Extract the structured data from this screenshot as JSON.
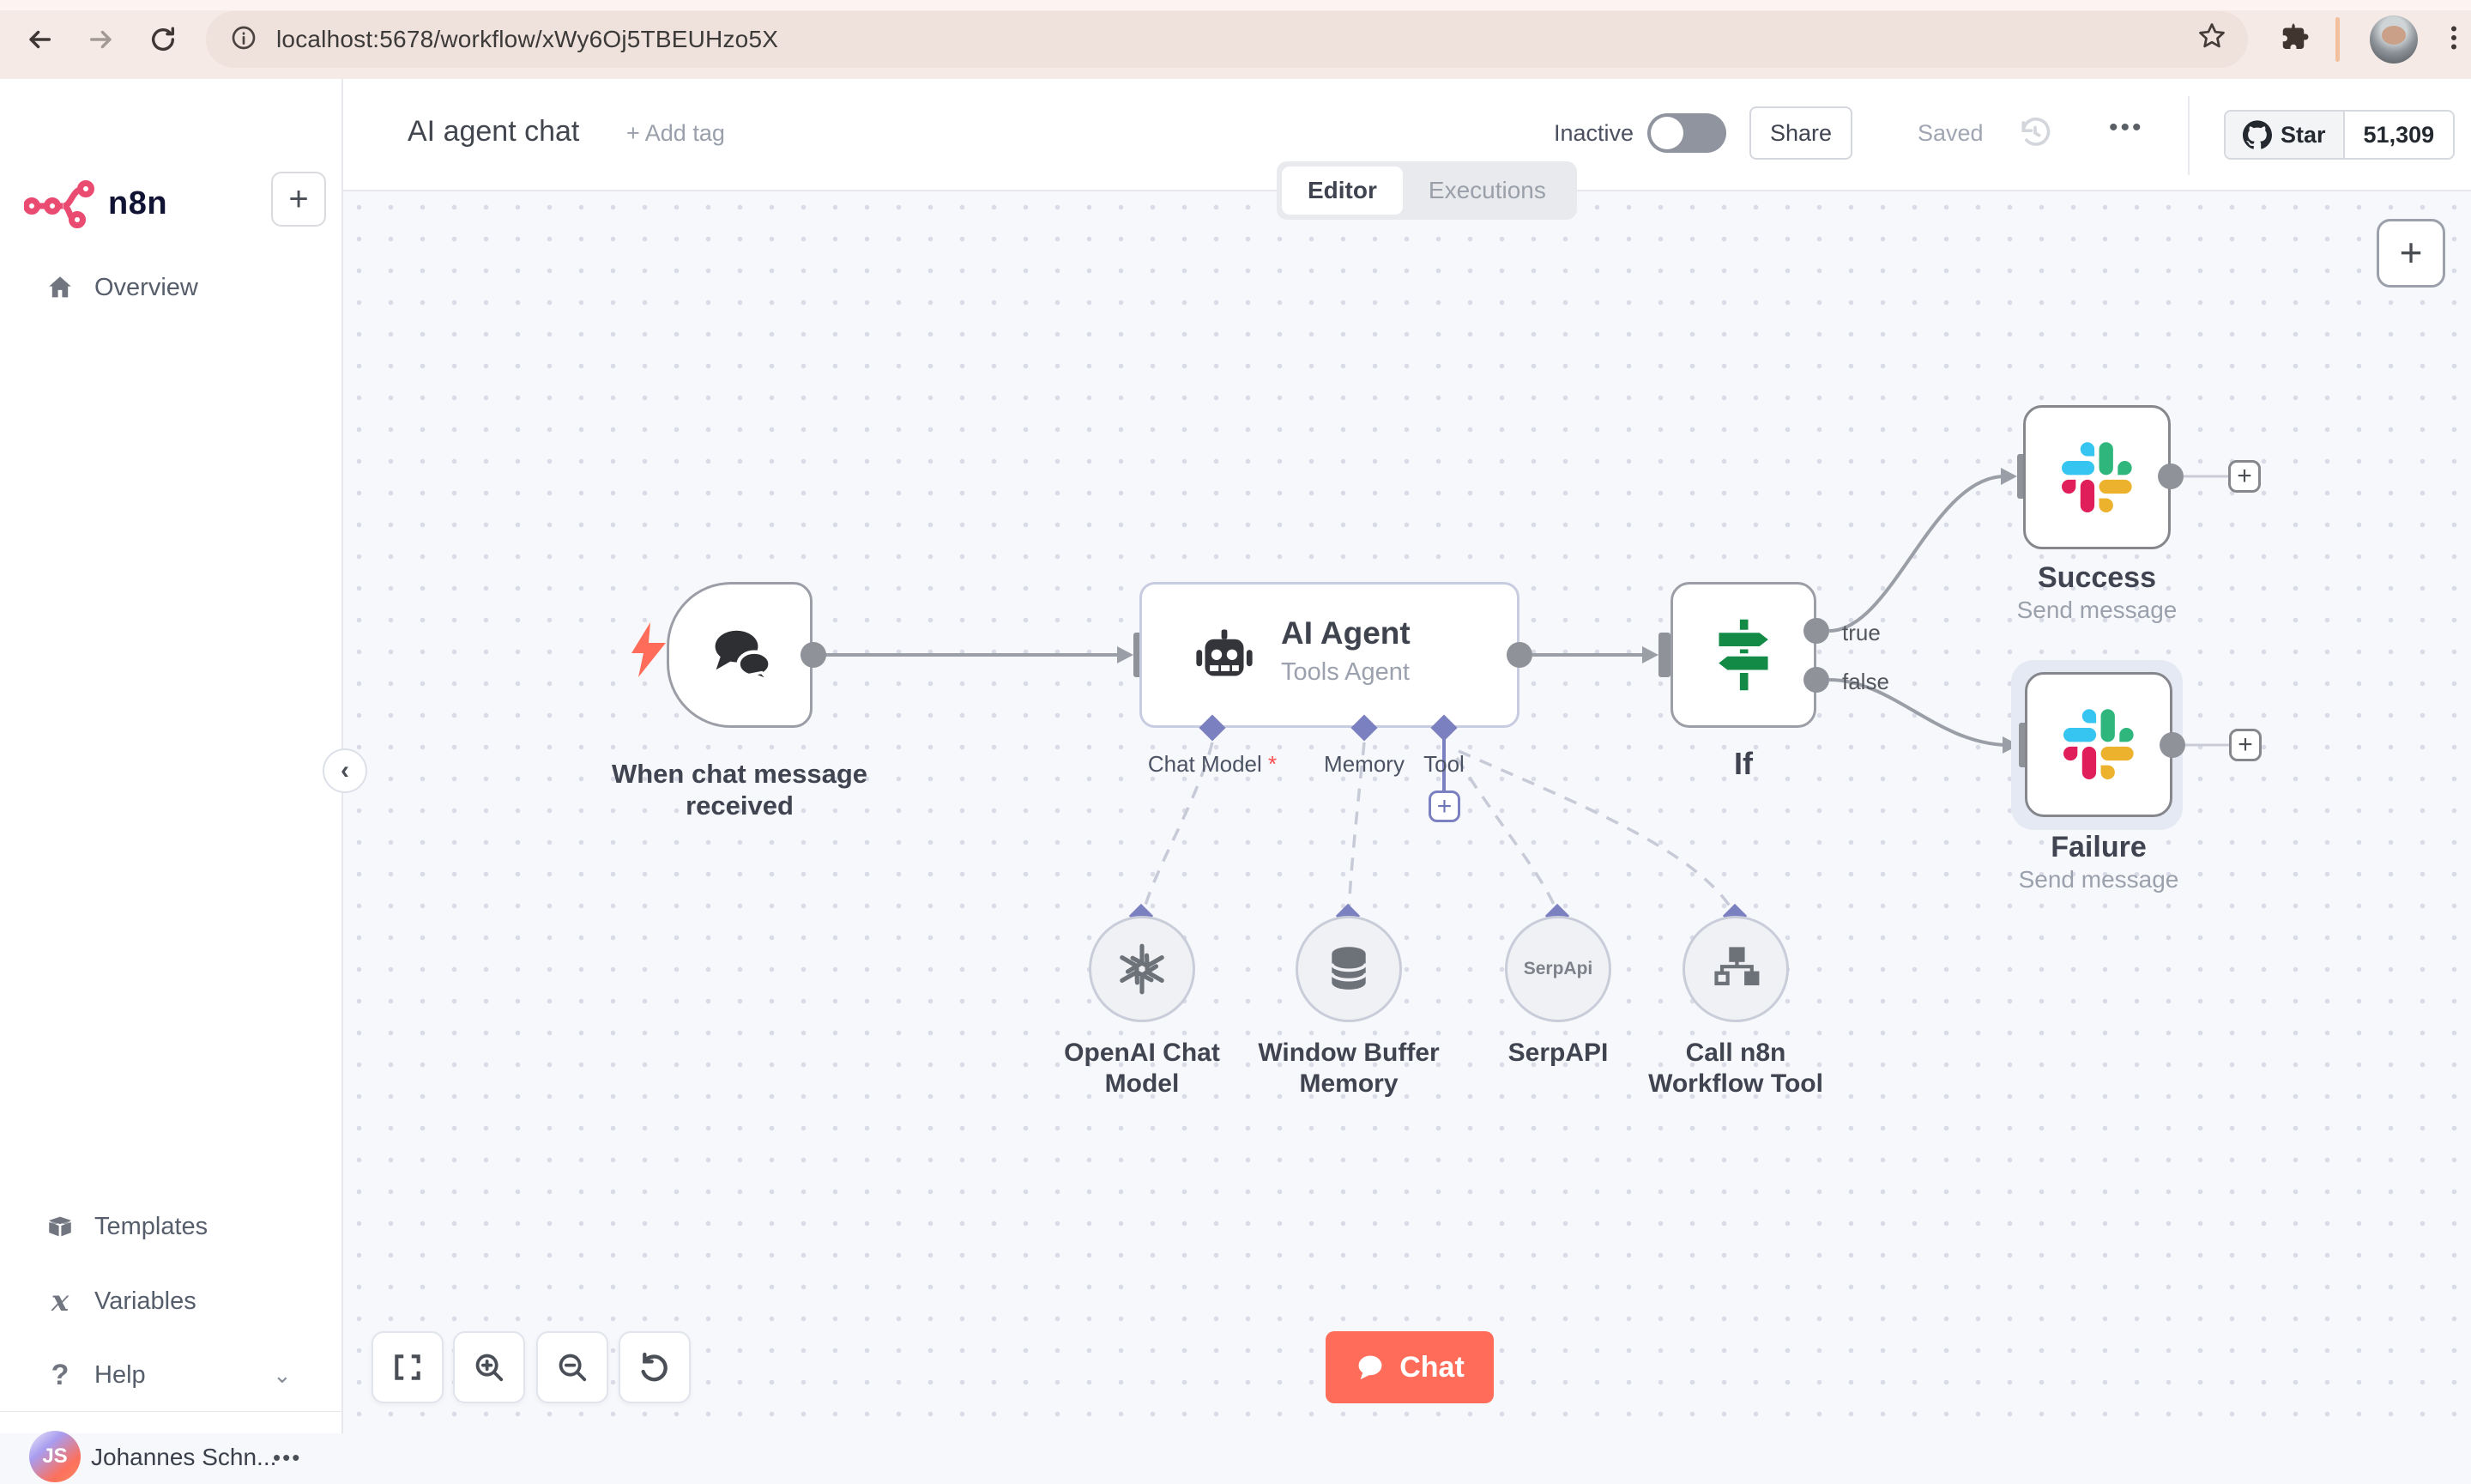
{
  "browser": {
    "url": "localhost:5678/workflow/xWy6Oj5TBEUHzo5X"
  },
  "sidebar": {
    "logo_text": "n8n",
    "new_workflow": "+",
    "items": [
      {
        "label": "Overview"
      },
      {
        "label": "Templates"
      },
      {
        "label": "Variables"
      },
      {
        "label": "Help"
      }
    ],
    "help_chevron": "⌄",
    "user": {
      "initials": "JS",
      "name": "Johannes Schn...",
      "menu": "•••"
    }
  },
  "header": {
    "title": "AI agent chat",
    "add_tag": "+ Add tag",
    "status_label": "Inactive",
    "share_label": "Share",
    "saved_label": "Saved",
    "more": "•••",
    "github": {
      "star_label": "Star",
      "star_count": "51,309"
    }
  },
  "tabs": {
    "editor": "Editor",
    "executions": "Executions"
  },
  "canvas": {
    "trigger": {
      "label": "When chat message received"
    },
    "agent": {
      "title": "AI Agent",
      "subtitle": "Tools Agent",
      "ports": {
        "chat_model": "Chat Model",
        "required_mark": "*",
        "memory": "Memory",
        "tool": "Tool",
        "add": "+"
      }
    },
    "if_node": {
      "label": "If",
      "out_true": "true",
      "out_false": "false"
    },
    "success": {
      "title": "Success",
      "subtitle": "Send message",
      "add": "+"
    },
    "failure": {
      "title": "Failure",
      "subtitle": "Send message",
      "add": "+"
    },
    "subnodes": [
      {
        "label": "OpenAI Chat Model"
      },
      {
        "label": "Window Buffer Memory"
      },
      {
        "label": "SerpAPI",
        "icon_text": "SerpApi"
      },
      {
        "label": "Call n8n Workflow Tool"
      }
    ],
    "zoom_add": "+",
    "chat_button": "Chat",
    "collapse": "‹"
  },
  "colors": {
    "brand_pink": "#EA4B71",
    "accent_orange": "#FF6D5A",
    "port_purple": "#7B81C0",
    "if_green": "#148A47",
    "slack": [
      "#36C5F0",
      "#2EB67D",
      "#ECB22E",
      "#E01E5A"
    ]
  }
}
